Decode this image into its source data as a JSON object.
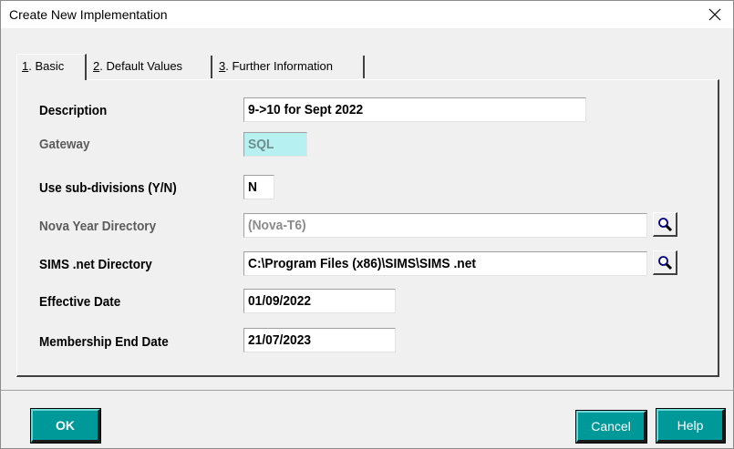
{
  "window": {
    "title": "Create New Implementation",
    "close_glyph": "✕"
  },
  "tabs": [
    {
      "hotkey": "1",
      "rest": ". Basic",
      "active": true
    },
    {
      "hotkey": "2",
      "rest": ". Default Values",
      "active": false
    },
    {
      "hotkey": "3",
      "rest": ". Further Information",
      "active": false
    }
  ],
  "form": {
    "description": {
      "label": "Description",
      "value": "9->10 for Sept 2022"
    },
    "gateway": {
      "label": "Gateway",
      "value": "SQL"
    },
    "sub_divisions": {
      "label": "Use sub-divisions (Y/N)",
      "value": "N"
    },
    "nova_dir": {
      "label": "Nova Year Directory",
      "value": "(Nova-T6)",
      "lookup_icon": "magnifier-icon"
    },
    "sims_dir": {
      "label": "SIMS .net Directory",
      "value": "C:\\Program Files (x86)\\SIMS\\SIMS .net",
      "lookup_icon": "magnifier-icon"
    },
    "effective_date": {
      "label": "Effective Date",
      "value": "01/09/2022"
    },
    "membership_end": {
      "label": "Membership End Date",
      "value": "21/07/2023"
    }
  },
  "buttons": {
    "ok": "OK",
    "cancel": "Cancel",
    "help": "Help"
  },
  "colors": {
    "button_teal": "#009999",
    "gateway_field": "#b7f0f0"
  }
}
